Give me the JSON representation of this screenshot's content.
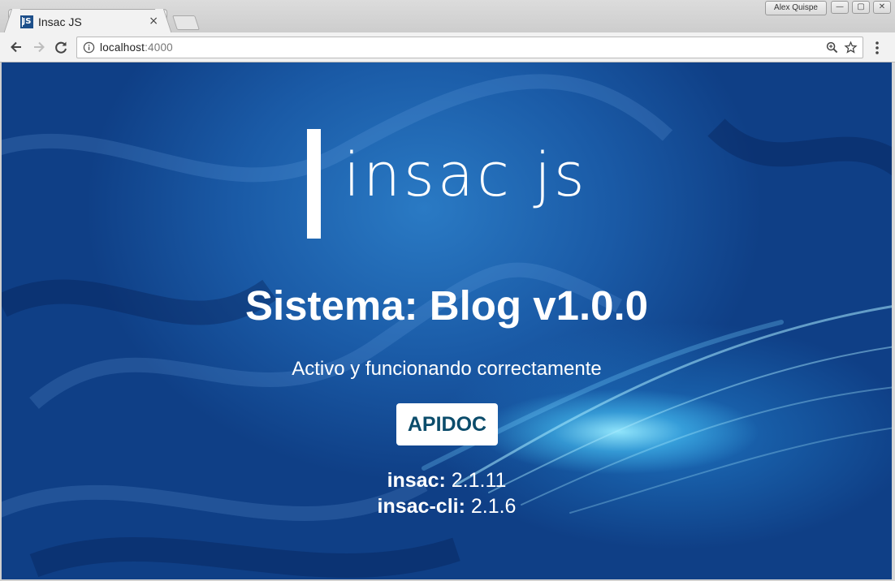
{
  "tab": {
    "title": "Insac JS",
    "close": "×",
    "favicon": "insac-js-favicon"
  },
  "window": {
    "user": "Alex Quispe",
    "buttons": [
      "minimize",
      "maximize",
      "close"
    ]
  },
  "toolbar": {
    "back_icon": "arrow-left-icon",
    "forward_icon": "arrow-right-icon",
    "reload_icon": "reload-icon",
    "url_host": "localhost",
    "url_port": ":4000",
    "info_icon": "info-icon",
    "zoom_icon": "zoom-icon",
    "bookmark_icon": "star-icon",
    "menu_icon": "kebab-menu-icon"
  },
  "page": {
    "logo_text": "insac js",
    "headline": "Sistema: Blog v1.0.0",
    "subline": "Activo y funcionando correctamente",
    "button": "APIDOC",
    "versions": [
      {
        "name": "insac:",
        "value": " 2.1.11"
      },
      {
        "name": "insac-cli:",
        "value": " 2.1.6"
      }
    ]
  },
  "colors": {
    "button_text": "#0b4c6b",
    "background": "#0f3f86"
  }
}
